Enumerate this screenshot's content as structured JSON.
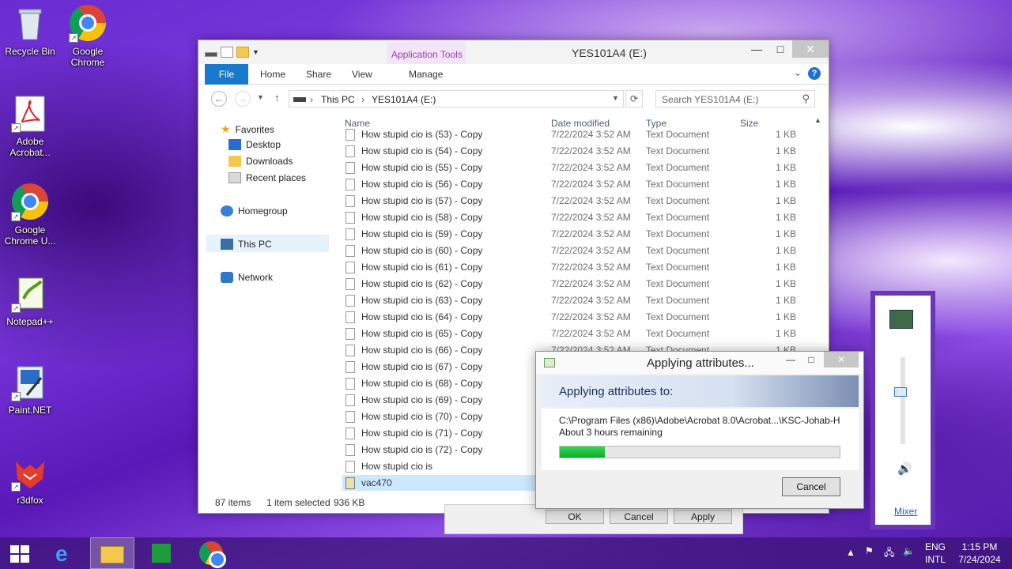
{
  "desktop": {
    "icons": [
      {
        "label": "Recycle Bin",
        "icon": "recycle-bin-icon"
      },
      {
        "label": "Google Chrome",
        "icon": "chrome-icon"
      },
      {
        "label": "Adobe Acrobat...",
        "icon": "acrobat-icon"
      },
      {
        "label": "Google Chrome U...",
        "icon": "chrome-icon"
      },
      {
        "label": "Notepad++",
        "icon": "notepadpp-icon"
      },
      {
        "label": "Paint.NET",
        "icon": "paintnet-icon"
      },
      {
        "label": "r3dfox",
        "icon": "r3dfox-icon"
      }
    ]
  },
  "explorer": {
    "title": "YES101A4 (E:)",
    "contextual_group": "Application Tools",
    "ribbon_tabs": [
      "File",
      "Home",
      "Share",
      "View",
      "Manage"
    ],
    "address": {
      "root": "This PC",
      "drive": "YES101A4 (E:)"
    },
    "search_placeholder": "Search YES101A4 (E:)",
    "nav": {
      "favorites": "Favorites",
      "desktop": "Desktop",
      "downloads": "Downloads",
      "recent": "Recent places",
      "homegroup": "Homegroup",
      "this_pc": "This PC",
      "network": "Network"
    },
    "columns": [
      "Name",
      "Date modified",
      "Type",
      "Size"
    ],
    "files": [
      {
        "name": "How stupid cio is (53) - Copy",
        "date": "7/22/2024 3:52 AM",
        "type": "Text Document",
        "size": "1 KB"
      },
      {
        "name": "How stupid cio is (54) - Copy",
        "date": "7/22/2024 3:52 AM",
        "type": "Text Document",
        "size": "1 KB"
      },
      {
        "name": "How stupid cio is (55) - Copy",
        "date": "7/22/2024 3:52 AM",
        "type": "Text Document",
        "size": "1 KB"
      },
      {
        "name": "How stupid cio is (56) - Copy",
        "date": "7/22/2024 3:52 AM",
        "type": "Text Document",
        "size": "1 KB"
      },
      {
        "name": "How stupid cio is (57) - Copy",
        "date": "7/22/2024 3:52 AM",
        "type": "Text Document",
        "size": "1 KB"
      },
      {
        "name": "How stupid cio is (58) - Copy",
        "date": "7/22/2024 3:52 AM",
        "type": "Text Document",
        "size": "1 KB"
      },
      {
        "name": "How stupid cio is (59) - Copy",
        "date": "7/22/2024 3:52 AM",
        "type": "Text Document",
        "size": "1 KB"
      },
      {
        "name": "How stupid cio is (60) - Copy",
        "date": "7/22/2024 3:52 AM",
        "type": "Text Document",
        "size": "1 KB"
      },
      {
        "name": "How stupid cio is (61) - Copy",
        "date": "7/22/2024 3:52 AM",
        "type": "Text Document",
        "size": "1 KB"
      },
      {
        "name": "How stupid cio is (62) - Copy",
        "date": "7/22/2024 3:52 AM",
        "type": "Text Document",
        "size": "1 KB"
      },
      {
        "name": "How stupid cio is (63) - Copy",
        "date": "7/22/2024 3:52 AM",
        "type": "Text Document",
        "size": "1 KB"
      },
      {
        "name": "How stupid cio is (64) - Copy",
        "date": "7/22/2024 3:52 AM",
        "type": "Text Document",
        "size": "1 KB"
      },
      {
        "name": "How stupid cio is (65) - Copy",
        "date": "7/22/2024 3:52 AM",
        "type": "Text Document",
        "size": "1 KB"
      },
      {
        "name": "How stupid cio is (66) - Copy",
        "date": "7/22/2024 3:52 AM",
        "type": "Text Document",
        "size": "1 KB"
      },
      {
        "name": "How stupid cio is (67) - Copy",
        "date": "",
        "type": "",
        "size": ""
      },
      {
        "name": "How stupid cio is (68) - Copy",
        "date": "",
        "type": "",
        "size": ""
      },
      {
        "name": "How stupid cio is (69) - Copy",
        "date": "",
        "type": "",
        "size": ""
      },
      {
        "name": "How stupid cio is (70) - Copy",
        "date": "",
        "type": "",
        "size": ""
      },
      {
        "name": "How stupid cio is (71) - Copy",
        "date": "",
        "type": "",
        "size": ""
      },
      {
        "name": "How stupid cio is (72) - Copy",
        "date": "",
        "type": "",
        "size": ""
      },
      {
        "name": "How stupid cio is",
        "date": "",
        "type": "",
        "size": ""
      },
      {
        "name": "vac470",
        "date": "",
        "type": "",
        "size": ""
      }
    ],
    "status": {
      "items": "87 items",
      "selected": "1 item selected",
      "size": "936 KB"
    }
  },
  "behind_dialog": {
    "ok": "OK",
    "cancel": "Cancel",
    "apply": "Apply"
  },
  "apply_dialog": {
    "title": "Applying attributes...",
    "heading": "Applying attributes to:",
    "path": "C:\\Program Files (x86)\\Adobe\\Acrobat 8.0\\Acrobat...\\KSC-Johab-H",
    "remaining": "About 3 hours remaining",
    "progress": 0.16,
    "cancel": "Cancel"
  },
  "volume": {
    "mixer": "Mixer",
    "level": 0.6
  },
  "taskbar": {
    "lang_top": "ENG",
    "lang_bottom": "INTL",
    "time": "1:15 PM",
    "date": "7/24/2024"
  },
  "colors": {
    "accent": "#1979ca",
    "progress": "#06b025",
    "app_tools": "#9b3fb0"
  }
}
